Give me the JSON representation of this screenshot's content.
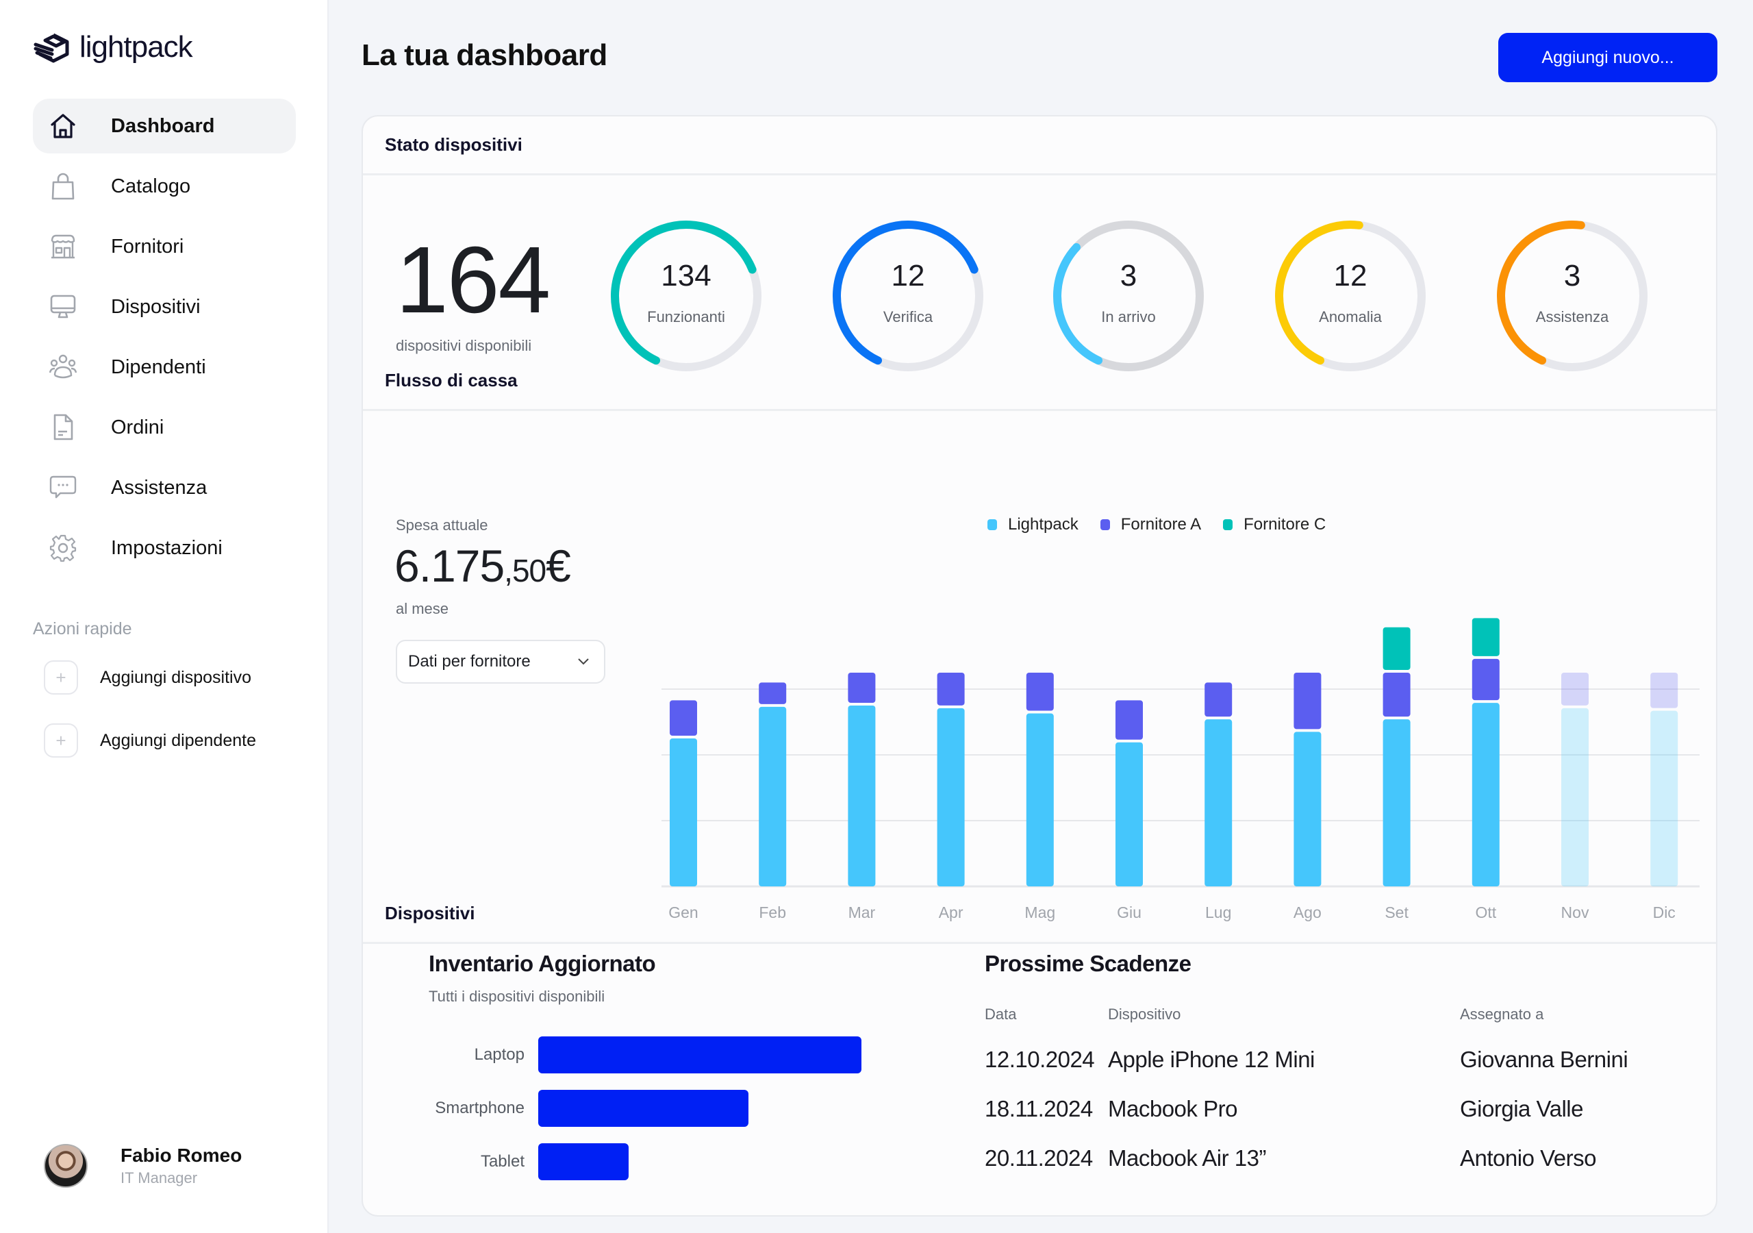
{
  "app": {
    "brand": "lightpack"
  },
  "sidebar": {
    "items": [
      {
        "label": "Dashboard",
        "icon": "home-icon",
        "active": true
      },
      {
        "label": "Catalogo",
        "icon": "shopping-bag-icon"
      },
      {
        "label": "Fornitori",
        "icon": "store-icon"
      },
      {
        "label": "Dispositivi",
        "icon": "monitor-icon"
      },
      {
        "label": "Dipendenti",
        "icon": "users-icon"
      },
      {
        "label": "Ordini",
        "icon": "document-icon"
      },
      {
        "label": "Assistenza",
        "icon": "chat-icon"
      },
      {
        "label": "Impostazioni",
        "icon": "gear-icon"
      }
    ],
    "quick_actions_title": "Azioni rapide",
    "quick_actions": [
      {
        "label": "Aggiungi dispositivo",
        "icon": "plus-icon"
      },
      {
        "label": "Aggiungi dipendente",
        "icon": "plus-icon"
      }
    ],
    "user": {
      "name": "Fabio Romeo",
      "role": "IT Manager"
    }
  },
  "header": {
    "title": "La tua dashboard",
    "add_button": "Aggiungi nuovo..."
  },
  "device_status": {
    "section_title": "Stato dispositivi",
    "total": "164",
    "total_label": "dispositivi disponibili",
    "gauges": [
      {
        "value": "134",
        "label": "Funzionanti",
        "fraction": 0.62,
        "color": "#00c2b8",
        "track": "#e6e7ec"
      },
      {
        "value": "12",
        "label": "Verifica",
        "fraction": 0.62,
        "color": "#0a74f5",
        "track": "#e6e7ec"
      },
      {
        "value": "3",
        "label": "In arrivo",
        "fraction": 0.3,
        "color": "#45c6fc",
        "track": "#d7d8dc"
      },
      {
        "value": "12",
        "label": "Anomalia",
        "fraction": 0.45,
        "color": "#fccb06",
        "track": "#e6e7ec"
      },
      {
        "value": "3",
        "label": "Assistenza",
        "fraction": 0.45,
        "color": "#fb9206",
        "track": "#e6e7ec"
      }
    ]
  },
  "cash_flow": {
    "section_title": "Flusso di cassa",
    "spend_label": "Spesa attuale",
    "spend_main": "6.175",
    "spend_cents": ",50",
    "spend_currency": "€",
    "per_month": "al mese",
    "select_value": "Dati per fornitore"
  },
  "chart_data": {
    "type": "bar",
    "stacked": true,
    "title": "",
    "xlabel": "",
    "ylabel": "",
    "categories": [
      "Gen",
      "Feb",
      "Mar",
      "Apr",
      "Mag",
      "Giu",
      "Lug",
      "Ago",
      "Set",
      "Ott",
      "Nov",
      "Dic"
    ],
    "series": [
      {
        "name": "Lightpack",
        "color": "#45c6fc",
        "values": [
          2.25,
          2.73,
          2.75,
          2.71,
          2.63,
          2.19,
          2.54,
          2.35,
          2.54,
          2.79,
          2.71,
          2.67
        ]
      },
      {
        "name": "Fornitore A",
        "color": "#5b5ef0",
        "values": [
          0.58,
          0.37,
          0.5,
          0.54,
          0.62,
          0.64,
          0.56,
          0.9,
          0.71,
          0.67,
          0.54,
          0.58
        ]
      },
      {
        "name": "Fornitore C",
        "color": "#00c2b8",
        "values": [
          0,
          0,
          0,
          0,
          0,
          0,
          0,
          0,
          0.69,
          0.62,
          0,
          0
        ]
      }
    ],
    "projected": [
      "Nov",
      "Dic"
    ],
    "ylim": [
      0,
      4.3
    ],
    "gridlines": [
      0,
      1,
      2,
      3
    ],
    "grid": true,
    "y_tick_labels": false,
    "legend_position": "top-center"
  },
  "devices": {
    "section_title": "Dispositivi",
    "inventory": {
      "title": "Inventario Aggiornato",
      "subtitle": "Tutti i dispositivi disponibili",
      "bars": [
        {
          "label": "Laptop",
          "fraction": 1.0
        },
        {
          "label": "Smartphone",
          "fraction": 0.65
        },
        {
          "label": "Tablet",
          "fraction": 0.28
        }
      ],
      "bar_color": "#0020f4"
    },
    "deadlines": {
      "title": "Prossime Scadenze",
      "columns": [
        "Data",
        "Dispositivo",
        "Assegnato a"
      ],
      "rows": [
        [
          "12.10.2024",
          "Apple iPhone 12 Mini",
          "Giovanna Bernini"
        ],
        [
          "18.11.2024",
          "Macbook Pro",
          "Giorgia Valle"
        ],
        [
          "20.11.2024",
          "Macbook Air 13”",
          "Antonio Verso"
        ]
      ]
    }
  },
  "colors": {
    "accent": "#0023f5",
    "background": "#f3f5f9"
  }
}
